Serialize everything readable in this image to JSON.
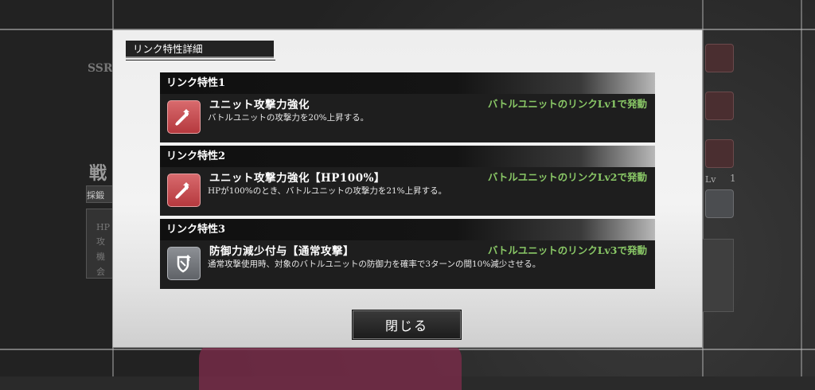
{
  "dialog": {
    "title": "リンク特性詳細",
    "close_label": "閉じる"
  },
  "links": [
    {
      "header": "リンク特性1",
      "icon": "sword-up-icon",
      "icon_color": "#c8494d",
      "name": "ユニット攻撃力強化",
      "condition": "バトルユニットのリンクLv1で発動",
      "description": "バトルユニットの攻撃力を20%上昇する。"
    },
    {
      "header": "リンク特性2",
      "icon": "sword-up-icon",
      "icon_color": "#c8494d",
      "name": "ユニット攻撃力強化【HP100%】",
      "condition": "バトルユニットのリンクLv2で発動",
      "description": "HPが100%のとき、バトルユニットの攻撃力を21%上昇する。"
    },
    {
      "header": "リンク特性3",
      "icon": "shield-down-icon",
      "icon_color": "#7a7d82",
      "name": "防御力減少付与【通常攻撃】",
      "condition": "バトルユニットのリンクLv3で発動",
      "description": "通常攻撃使用時、対象のバトルユニットの防御力を確率で3ターンの間10%減少させる。"
    }
  ],
  "background": {
    "badge": "SSR",
    "title_char": "戦",
    "tab": "採鍛",
    "list": [
      "HP",
      "攻",
      "機",
      "会"
    ],
    "lv_label": "Lv",
    "lv_value": "1"
  },
  "colors": {
    "condition_text": "#89c766",
    "card_bg": "#1e1e1e",
    "modal_bg": "#eeeeee"
  }
}
